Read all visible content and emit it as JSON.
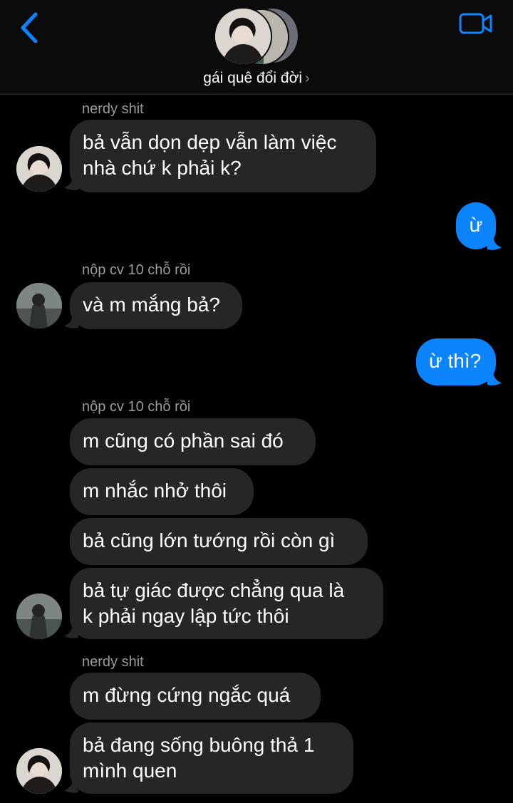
{
  "header": {
    "title": "gái quê đổi đời",
    "back_icon": "chevron-left-icon",
    "video_icon": "video-camera-icon",
    "accent": "#0b84fe"
  },
  "messages": {
    "m1_sender": "nerdy shit",
    "m1_text_l1": "bả vẫn dọn dẹp vẫn làm việc",
    "m1_text_l2": "nhà chứ k phải k?",
    "m2_text": "ừ",
    "m3_sender": "nộp cv 10 chỗ rồi",
    "m3_text": "và m mắng bả?",
    "m4_text": "ừ thì?",
    "m5_sender": "nộp cv 10 chỗ rồi",
    "m5_text": "m cũng có phần sai đó",
    "m6_text": "m nhắc nhở thôi",
    "m7_text": "bả cũng lớn tướng rồi còn gì",
    "m8_text_l1": "bả tự giác được chẳng qua là",
    "m8_text_l2": "k phải ngay lập tức thôi",
    "m9_sender": "nerdy shit",
    "m9_text": "m đừng cứng ngắc quá",
    "m10_text_l1": "bả đang sống buông thả 1",
    "m10_text_l2": "mình quen"
  },
  "colors": {
    "incoming_bubble": "#262629",
    "outgoing_bubble": "#0b84fe",
    "sender_name": "#9a9aa0"
  }
}
